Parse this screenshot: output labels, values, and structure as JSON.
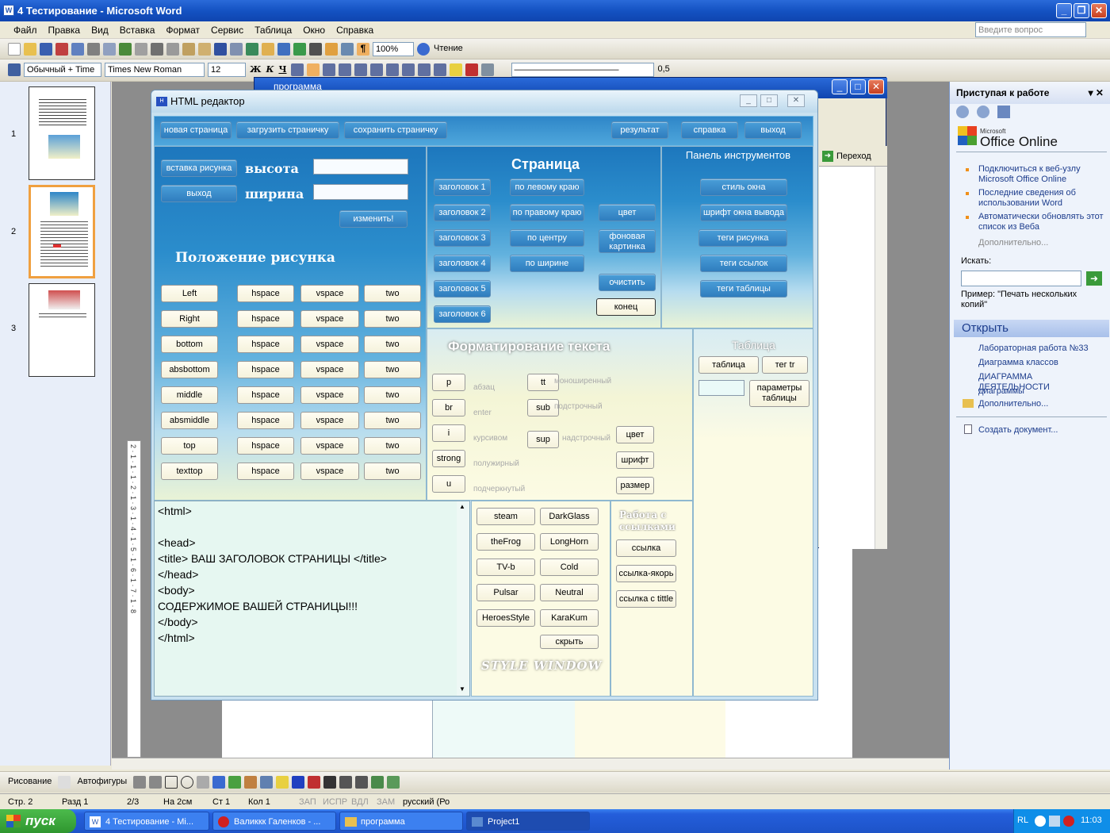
{
  "word": {
    "title": "4 Тестирование - Microsoft Word",
    "menu": [
      "Файл",
      "Правка",
      "Вид",
      "Вставка",
      "Формат",
      "Сервис",
      "Таблица",
      "Окно",
      "Справка"
    ],
    "ask_placeholder": "Введите вопрос",
    "zoom": "100%",
    "read_btn": "Чтение",
    "style": "Обычный + Time",
    "font": "Times New Roman",
    "font_size": "12",
    "line_width": "0,5",
    "bold": "Ж",
    "italic": "К",
    "underline": "Ч",
    "thumbs": [
      "1",
      "2",
      "3"
    ],
    "ruler": "2 · 1 · 1 · 1 · 2 · 1 · 3 · 1 · 4 · 1 · 5 · 1 · 6 · 1 · 7 · 1 · 8",
    "draw_label": "Рисование",
    "autoshapes": "Автофигуры",
    "status": {
      "page": "Стр. 2",
      "section": "Разд 1",
      "pages": "2/3",
      "at": "На 2см",
      "line": "Ст 1",
      "col": "Кол 1",
      "rec": "ЗАП",
      "trk": "ИСПР",
      "ext": "ВДЛ",
      "ovr": "ЗАМ",
      "lang": "русский (Ро"
    }
  },
  "taskpane": {
    "title": "Приступая к работе",
    "brand_small": "Microsoft",
    "brand": "Office Online",
    "links": [
      "Подключиться к веб-узлу Microsoft Office Online",
      "Последние сведения об использовании Word",
      "Автоматически обновлять этот список из Веба"
    ],
    "more": "Дополнительно...",
    "search_label": "Искать:",
    "example": "Пример: \"Печать нескольких копий\"",
    "open_header": "Открыть",
    "recent": [
      "Лабораторная работа №33",
      "Диаграмма классов",
      "ДИАГРАММА ДЕЯТЕЛЬНОСТИ",
      "диаграммы"
    ],
    "open_more": "Дополнительно...",
    "new_doc": "Создать документ..."
  },
  "explorer": {
    "title": "программа",
    "go": "Переход"
  },
  "editor": {
    "title": "HTML редактор",
    "top": [
      "новая страница",
      "загрузить страничку",
      "сохранить страничку",
      "результат",
      "справка",
      "выход"
    ],
    "img": {
      "insert": "вставка рисунка",
      "exit": "выход",
      "height": "высота",
      "width": "ширина",
      "change": "изменить!",
      "position": "Положение рисунка"
    },
    "align_rows": [
      {
        "label": "Left",
        "h": "hspace",
        "v": "vspace",
        "t": "two"
      },
      {
        "label": "Right",
        "h": "hspace",
        "v": "vspace",
        "t": "two"
      },
      {
        "label": "bottom",
        "h": "hspace",
        "v": "vspace",
        "t": "two"
      },
      {
        "label": "absbottom",
        "h": "hspace",
        "v": "vspace",
        "t": "two"
      },
      {
        "label": "middle",
        "h": "hspace",
        "v": "vspace",
        "t": "two"
      },
      {
        "label": "absmiddle",
        "h": "hspace",
        "v": "vspace",
        "t": "two"
      },
      {
        "label": "top",
        "h": "hspace",
        "v": "vspace",
        "t": "two"
      },
      {
        "label": "texttop",
        "h": "hspace",
        "v": "vspace",
        "t": "two"
      }
    ],
    "page": {
      "title": "Страница",
      "headers": [
        "заголовок 1",
        "заголовок 2",
        "заголовок 3",
        "заголовок 4",
        "заголовок 5",
        "заголовок 6"
      ],
      "align": [
        "по левому краю",
        "по правому краю",
        "по центру",
        "по ширине"
      ],
      "color": "цвет",
      "bg": "фоновая картинка",
      "clear": "очистить",
      "end": "конец"
    },
    "tools": {
      "title": "Панель инструментов",
      "items": [
        "стиль окна",
        "шрифт окна вывода",
        "теги рисунка",
        "теги ссылок",
        "теги таблицы"
      ]
    },
    "fmt": {
      "title": "Форматирование текста",
      "left": [
        "p",
        "br",
        "i",
        "strong",
        "u"
      ],
      "left_lbl": [
        "абзац",
        "enter",
        "курсивом",
        "полужирный",
        "подчеркнутый"
      ],
      "mid": [
        "tt",
        "sub",
        "sup"
      ],
      "mid_lbl": [
        "моноширенный",
        "подстрочный",
        "надстрочный"
      ],
      "right": [
        "цвет",
        "шрифт",
        "размер"
      ]
    },
    "table": {
      "title": "Таблица",
      "tbl": "таблица",
      "tr": "тег tr",
      "params": "параметры таблицы"
    },
    "code": [
      "<html>",
      "",
      "<head>",
      "<title> ВАШ ЗАГОЛОВОК СТРАНИЦЫ </title>",
      "</head>",
      "<body>",
      "СОДЕРЖИМОЕ ВАШЕЙ СТРАНИЦЫ!!!",
      "</body>",
      "</html>"
    ],
    "styles": [
      "steam",
      "DarkGlass",
      "theFrog",
      "LongHorn",
      "TV-b",
      "Cold",
      "Pulsar",
      "Neutral",
      "HeroesStyle",
      "KaraKum"
    ],
    "hide": "скрыть",
    "style_window": "STYLE WINDOW",
    "links": {
      "title": "Работа с ссылками",
      "items": [
        "ссылка",
        "ссылка-якорь",
        "ссылка с tittle"
      ]
    }
  },
  "taskbar": {
    "start": "пуск",
    "tasks": [
      "4 Тестирование - Mi...",
      "Валиккк Галенков - ...",
      "программа",
      "Project1"
    ],
    "lang": "RL",
    "time": "11:03"
  }
}
